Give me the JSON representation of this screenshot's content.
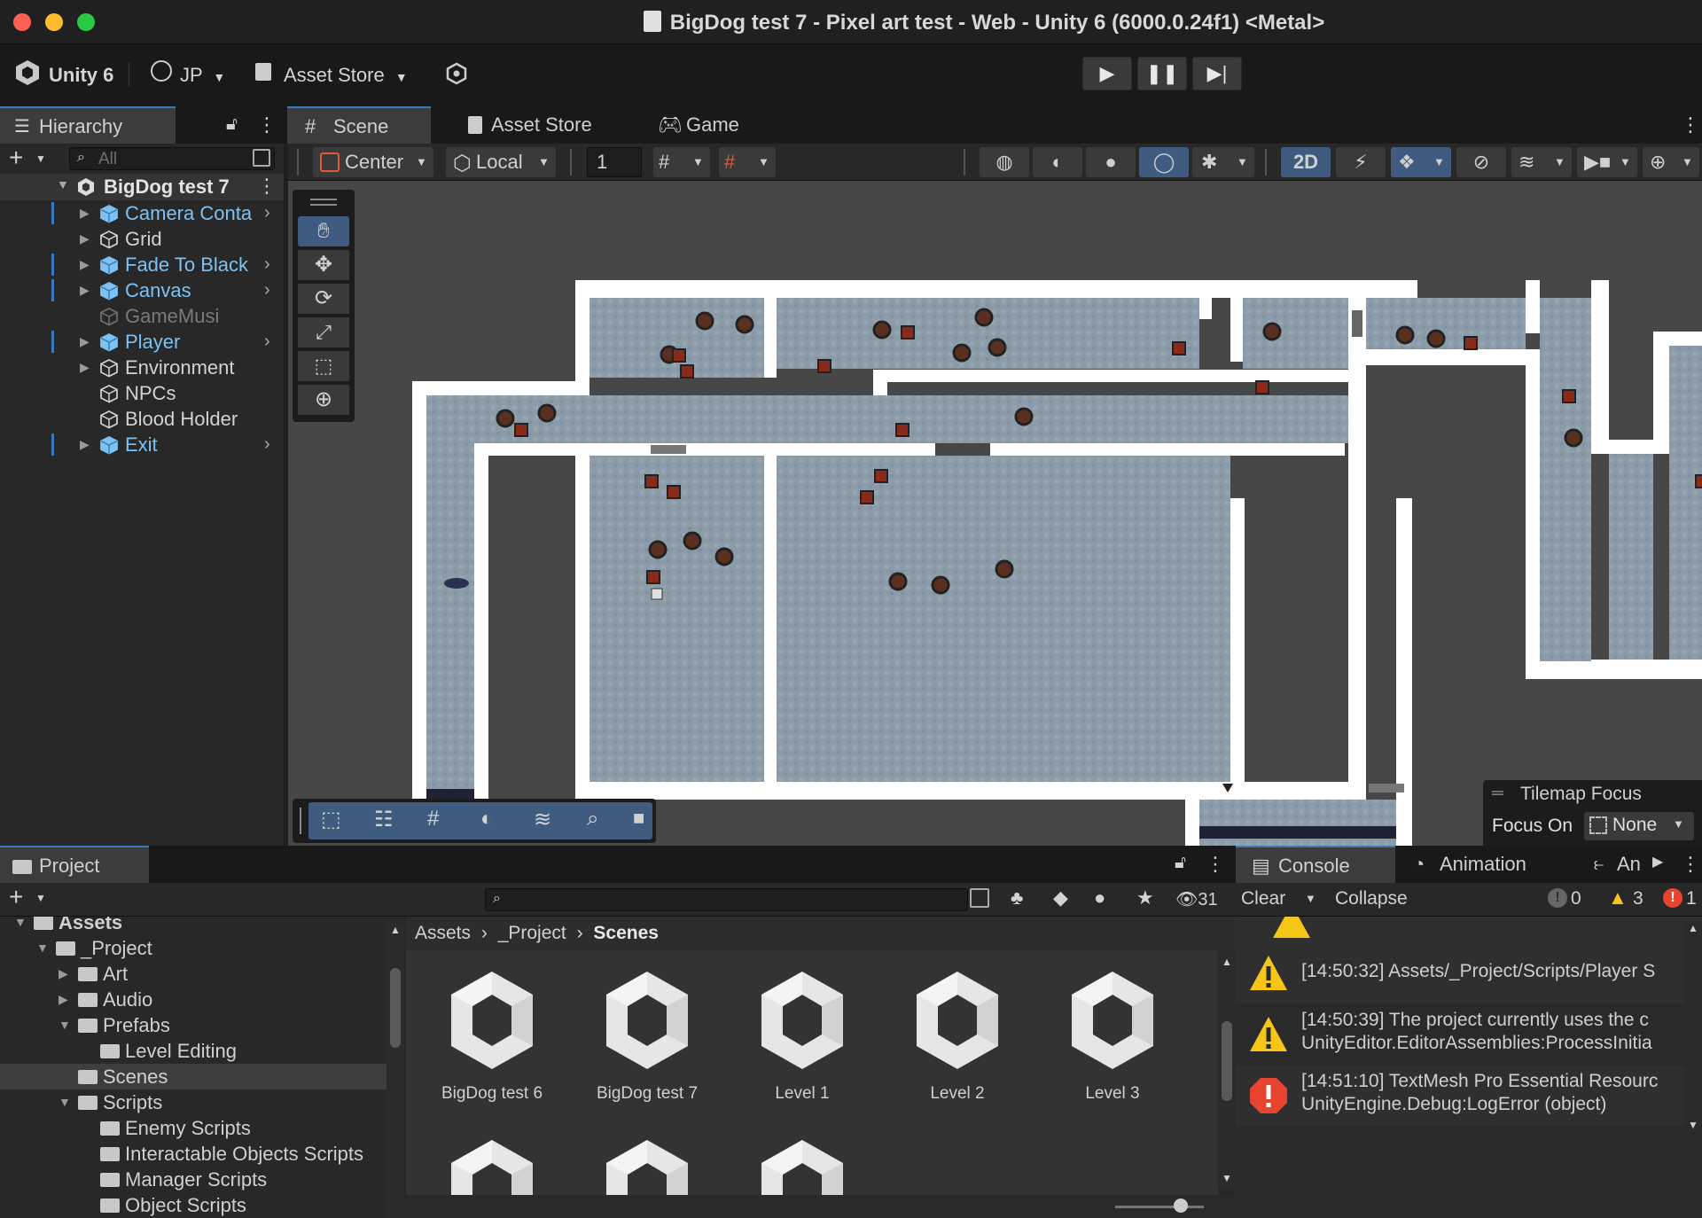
{
  "window": {
    "title": "BigDog test 7 - Pixel art test - Web - Unity 6 (6000.0.24f1) <Metal>"
  },
  "toolbar": {
    "unity_label": "Unity 6",
    "account_label": "JP",
    "asset_store_label": "Asset Store"
  },
  "tabs": {
    "hierarchy": "Hierarchy",
    "scene": "Scene",
    "asset_store": "Asset Store",
    "game": "Game",
    "project": "Project",
    "console": "Console",
    "animation": "Animation",
    "animator": "An"
  },
  "hierarchy": {
    "search_placeholder": "All",
    "scene_name": "BigDog test 7",
    "items": [
      {
        "label": "Camera Conta",
        "prefab": true,
        "expandable": true
      },
      {
        "label": "Grid",
        "prefab": false,
        "expandable": true
      },
      {
        "label": "Fade To Black",
        "prefab": true,
        "expandable": true
      },
      {
        "label": "Canvas",
        "prefab": true,
        "expandable": true
      },
      {
        "label": "GameMusi",
        "prefab": false,
        "expandable": false,
        "disabled": true
      },
      {
        "label": "Player",
        "prefab": true,
        "expandable": true
      },
      {
        "label": "Environment",
        "prefab": false,
        "expandable": true
      },
      {
        "label": "NPCs",
        "prefab": false,
        "expandable": false
      },
      {
        "label": "Blood Holder",
        "prefab": false,
        "expandable": false
      },
      {
        "label": "Exit",
        "prefab": true,
        "expandable": true
      }
    ]
  },
  "scene_toolbar": {
    "pivot": "Center",
    "space": "Local",
    "grid_snap_value": "1",
    "mode_2d": "2D"
  },
  "tilemap_focus": {
    "title": "Tilemap Focus",
    "focus_on_label": "Focus On",
    "value": "None"
  },
  "project": {
    "tree": [
      {
        "label": "Assets",
        "depth": 0,
        "open": true
      },
      {
        "label": "_Project",
        "depth": 1,
        "open": true
      },
      {
        "label": "Art",
        "depth": 2,
        "open": false
      },
      {
        "label": "Audio",
        "depth": 2,
        "open": false
      },
      {
        "label": "Prefabs",
        "depth": 2,
        "open": true
      },
      {
        "label": "Level Editing",
        "depth": 3
      },
      {
        "label": "Scenes",
        "depth": 2,
        "selected": true
      },
      {
        "label": "Scripts",
        "depth": 2,
        "open": true
      },
      {
        "label": "Enemy Scripts",
        "depth": 3
      },
      {
        "label": "Interactable Objects Scripts",
        "depth": 3
      },
      {
        "label": "Manager Scripts",
        "depth": 3
      },
      {
        "label": "Object Scripts",
        "depth": 3
      }
    ],
    "breadcrumb": [
      "Assets",
      "_Project",
      "Scenes"
    ],
    "hidden_count": "31",
    "assets": [
      "BigDog test 6",
      "BigDog test 7",
      "Level 1",
      "Level 2",
      "Level 3"
    ]
  },
  "console": {
    "clear_label": "Clear",
    "collapse_label": "Collapse",
    "counts": {
      "info": "0",
      "warnings": "3",
      "errors": "1"
    },
    "entries": [
      {
        "type": "warning",
        "line1": "[14:50:32] Assets/_Project/Scripts/Player S",
        "line2": ""
      },
      {
        "type": "warning",
        "line1": "[14:50:39] The project currently uses the c",
        "line2": "UnityEditor.EditorAssemblies:ProcessInitia"
      },
      {
        "type": "error",
        "line1": "[14:51:10] TextMesh Pro Essential Resourc",
        "line2": "UnityEngine.Debug:LogError (object)"
      }
    ]
  },
  "colors": {
    "accent": "#3a79bb",
    "prefab_blue": "#7cc2f4",
    "warning": "#f5c518",
    "error": "#e8432e"
  }
}
